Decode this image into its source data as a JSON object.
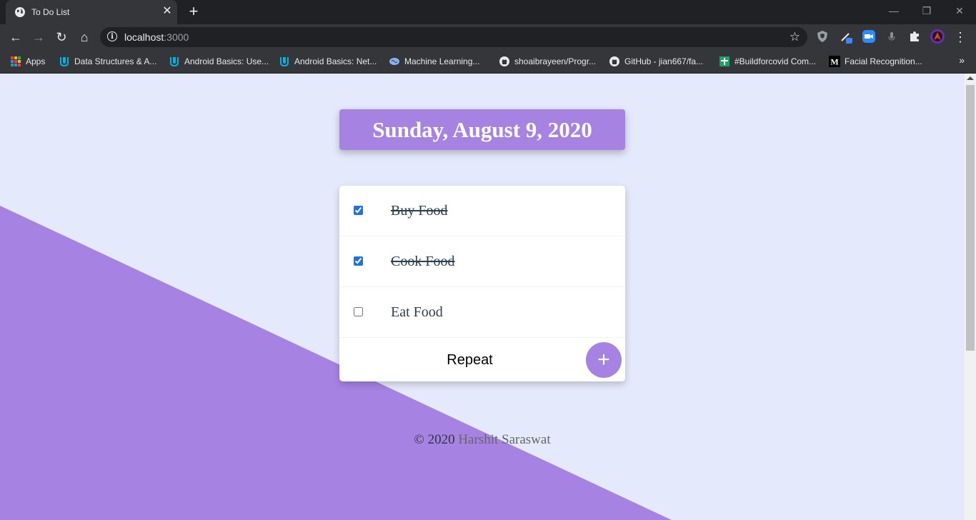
{
  "browser": {
    "tab_title": "To Do List",
    "tab_close": "✕",
    "new_tab": "+",
    "window_controls": {
      "minimize": "—",
      "restore": "❐",
      "close": "✕"
    },
    "nav": {
      "back": "←",
      "forward": "→",
      "reload": "↻",
      "home": "⌂"
    },
    "url_host": "localhost",
    "url_port": ":3000",
    "star": "☆",
    "menu": "⋮",
    "bookmarks": [
      {
        "label": "Apps",
        "icon": "apps-grid-icon",
        "color": "#e8eaed"
      },
      {
        "label": "Data Structures & A...",
        "icon": "udacity-icon",
        "color": "#02b3e4"
      },
      {
        "label": "Android Basics: Use...",
        "icon": "udacity-icon",
        "color": "#02b3e4"
      },
      {
        "label": "Android Basics: Net...",
        "icon": "udacity-icon",
        "color": "#02b3e4"
      },
      {
        "label": "Machine Learning...",
        "icon": "brain-icon",
        "color": "#8ab4f8"
      },
      {
        "label": "shoaibrayeen/Progr...",
        "icon": "github-icon",
        "color": "#e8eaed"
      },
      {
        "label": "GitHub - jian667/fa...",
        "icon": "github-icon",
        "color": "#e8eaed"
      },
      {
        "label": "#Buildforcovid Com...",
        "icon": "devpost-icon",
        "color": "#1fa363"
      },
      {
        "label": "Facial Recognition...",
        "icon": "medium-icon",
        "color": "#000000"
      }
    ],
    "bookmarks_more": "»"
  },
  "app": {
    "date_heading": "Sunday, August 9, 2020",
    "items": [
      {
        "text": "Buy Food",
        "checked": true
      },
      {
        "text": "Cook Food",
        "checked": true
      },
      {
        "text": "Eat Food",
        "checked": false
      }
    ],
    "new_item_value": "Repeat",
    "add_button": "+",
    "footer_prefix": "© 2020 ",
    "footer_author": "Harshit Saraswat"
  },
  "colors": {
    "accent": "#a683e3",
    "background": "#e4e9fb"
  }
}
